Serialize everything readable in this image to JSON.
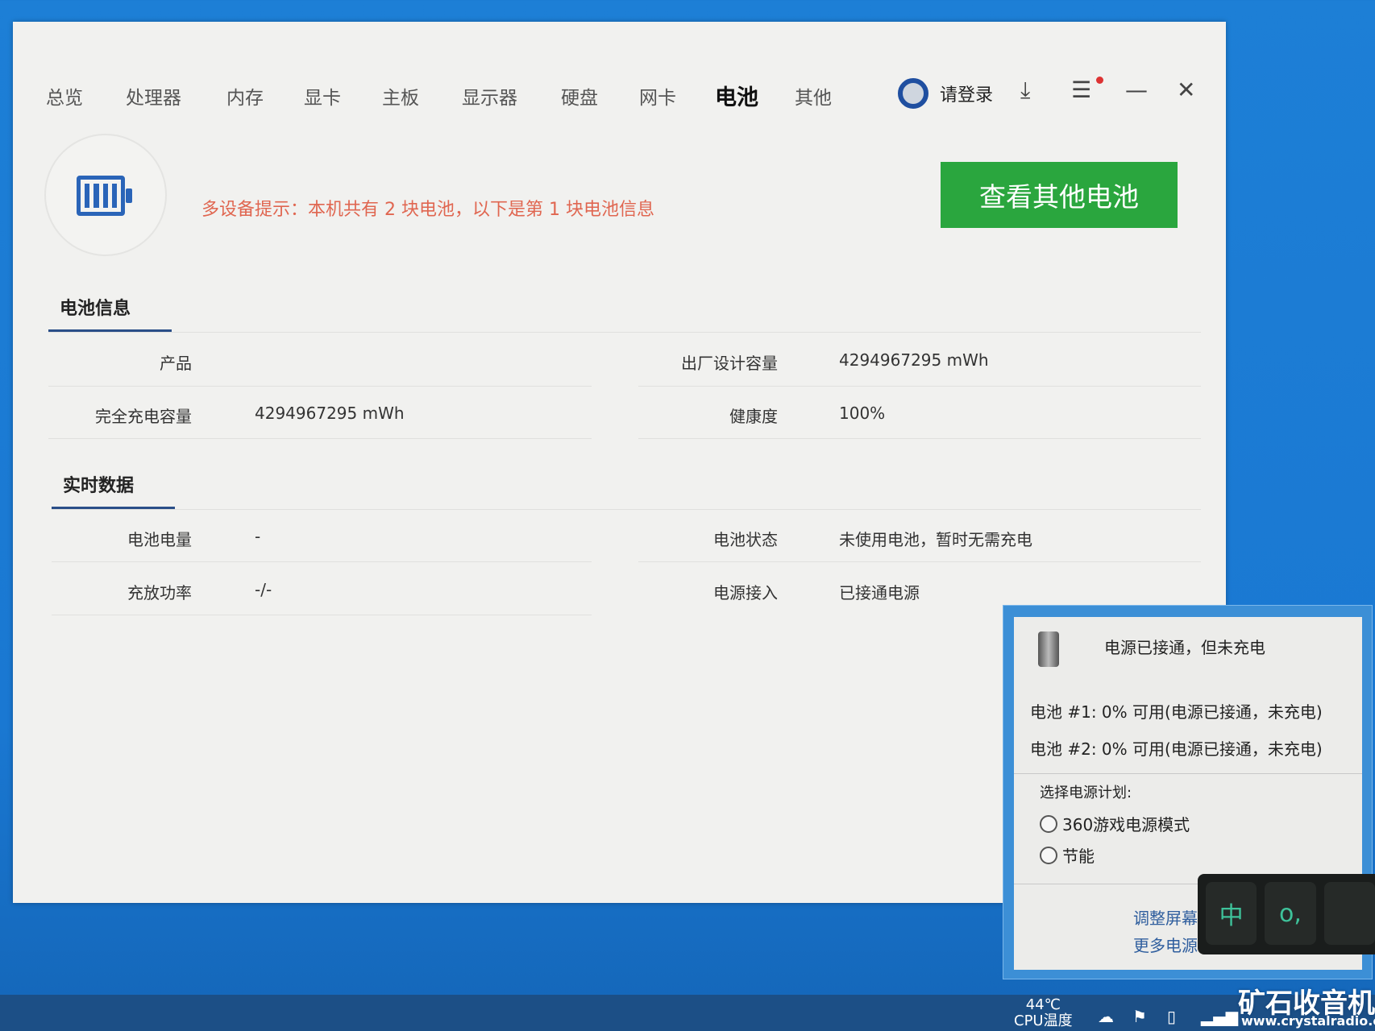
{
  "nav": {
    "tabs": [
      "总览",
      "处理器",
      "内存",
      "显卡",
      "主板",
      "显示器",
      "硬盘",
      "网卡",
      "电池",
      "其他"
    ],
    "active": "电池",
    "login": "请登录"
  },
  "header": {
    "notice": "多设备提示：本机共有 2 块电池，以下是第 1 块电池信息",
    "other_battery_button": "查看其他电池"
  },
  "battery_info": {
    "title": "电池信息",
    "rows": [
      {
        "label": "产品",
        "value": "",
        "label2": "出厂设计容量",
        "value2": "4294967295 mWh"
      },
      {
        "label": "完全充电容量",
        "value": "4294967295 mWh",
        "label2": "健康度",
        "value2": "100%"
      }
    ]
  },
  "realtime": {
    "title": "实时数据",
    "rows": [
      {
        "label": "电池电量",
        "value": "-",
        "label2": "电池状态",
        "value2": "未使用电池，暂时无需充电"
      },
      {
        "label": "充放功率",
        "value": "-/-",
        "label2": "电源接入",
        "value2": "已接通电源"
      }
    ]
  },
  "popup": {
    "status": "电源已接通，但未充电",
    "battery1": "电池 #1: 0% 可用(电源已接通，未充电)",
    "battery2": "电池 #2: 0% 可用(电源已接通，未充电)",
    "plan_label": "选择电源计划:",
    "plans": [
      "360游戏电源模式",
      "节能"
    ],
    "link1": "调整屏幕",
    "link2": "更多电源"
  },
  "ime": {
    "key1": "中",
    "key2": "o,"
  },
  "taskbar": {
    "temp": "44℃",
    "temp_label": "CPU温度"
  },
  "watermark": {
    "text": "矿石收音机",
    "url": "www.crystalradio.cn"
  }
}
